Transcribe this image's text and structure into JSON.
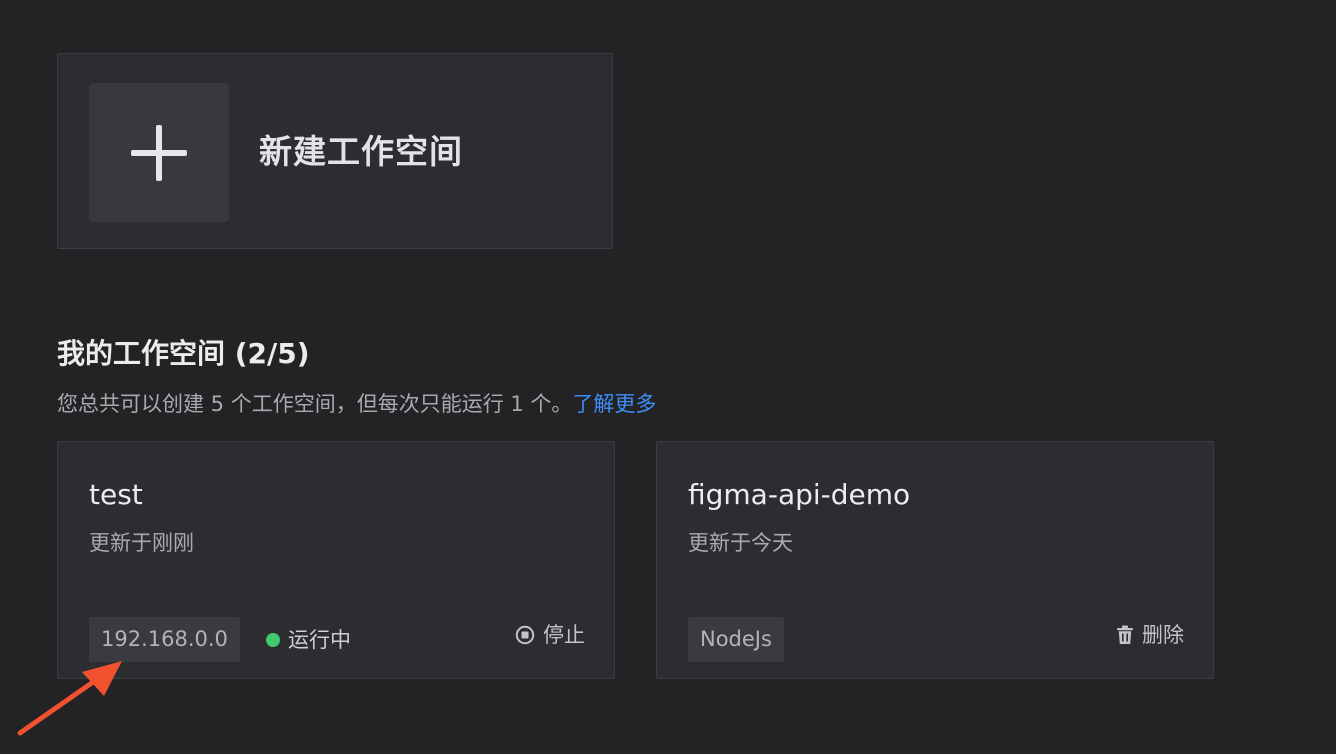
{
  "new_workspace": {
    "label": "新建工作空间",
    "icon": "plus-icon"
  },
  "section": {
    "title": "我的工作空间 (2/5)",
    "description": "您总共可以创建 5 个工作空间，但每次只能运行 1 个。",
    "learn_more": "了解更多"
  },
  "workspaces": [
    {
      "name": "test",
      "updated": "更新于刚刚",
      "tag": "192.168.0.0",
      "status": "运行中",
      "status_color": "#3fca70",
      "action": "停止",
      "action_icon": "stop-icon"
    },
    {
      "name": "figma-api-demo",
      "updated": "更新于今天",
      "tag": "NodeJs",
      "action": "删除",
      "action_icon": "trash-icon"
    }
  ],
  "colors": {
    "background": "#232326",
    "card": "#2c2d31",
    "link": "#3d8ef5",
    "annotation_arrow": "#f0522f"
  }
}
